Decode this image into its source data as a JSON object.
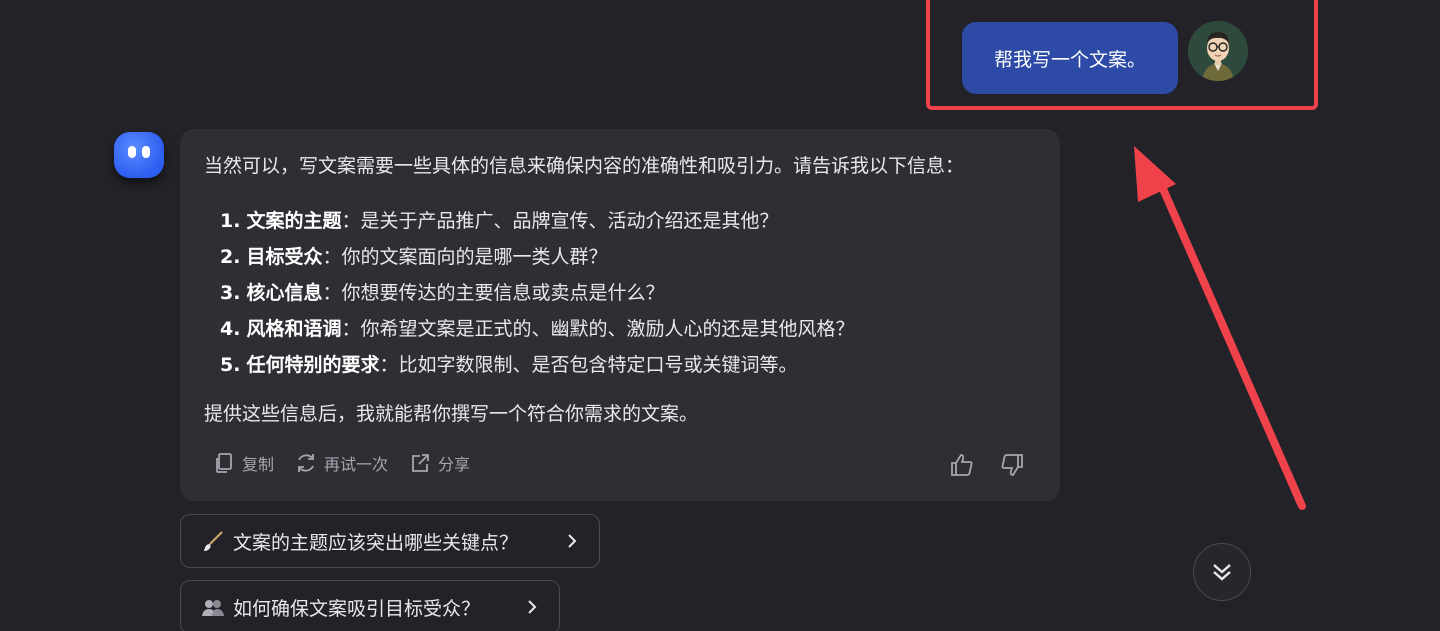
{
  "user_message": {
    "text": "帮我写一个文案。"
  },
  "bot_message": {
    "intro": "当然可以，写文案需要一些具体的信息来确保内容的准确性和吸引力。请告诉我以下信息：",
    "items": [
      {
        "num": "1.",
        "term": "文案的主题",
        "desc": "：是关于产品推广、品牌宣传、活动介绍还是其他？"
      },
      {
        "num": "2.",
        "term": "目标受众",
        "desc": "：你的文案面向的是哪一类人群？"
      },
      {
        "num": "3.",
        "term": "核心信息",
        "desc": "：你想要传达的主要信息或卖点是什么？"
      },
      {
        "num": "4.",
        "term": "风格和语调",
        "desc": "：你希望文案是正式的、幽默的、激励人心的还是其他风格？"
      },
      {
        "num": "5.",
        "term": "任何特别的要求",
        "desc": "：比如字数限制、是否包含特定口号或关键词等。"
      }
    ],
    "outro": "提供这些信息后，我就能帮你撰写一个符合你需求的文案。"
  },
  "actions": {
    "copy_label": "复制",
    "retry_label": "再试一次",
    "share_label": "分享"
  },
  "suggestions": [
    {
      "icon": "brush-icon",
      "text": "文案的主题应该突出哪些关键点？"
    },
    {
      "icon": "people-icon",
      "text": "如何确保文案吸引目标受众？"
    }
  ],
  "colors": {
    "background": "#222228",
    "user_bubble": "#2c4aa6",
    "bot_card": "#2e2e35",
    "highlight": "#f0424a",
    "bot_avatar": "#2d5ef0"
  }
}
